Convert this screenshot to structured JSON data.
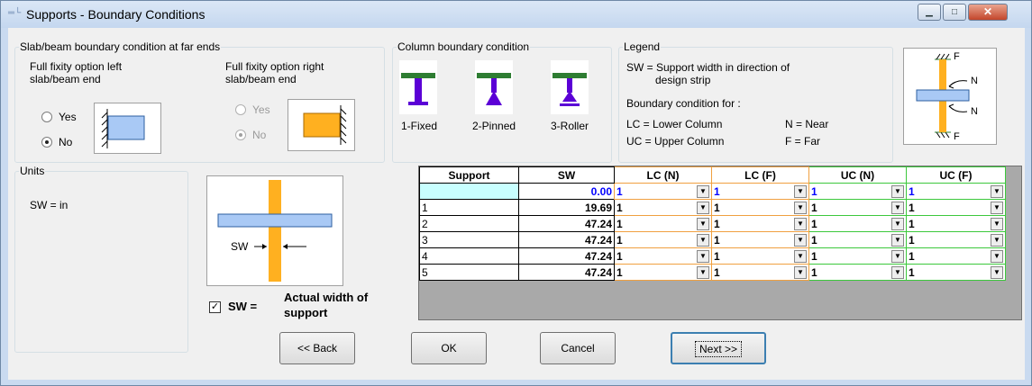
{
  "window": {
    "title": "Supports - Boundary Conditions",
    "icon": "supports-app-icon",
    "controls": {
      "minimize": "minimize-icon",
      "maximize": "maximize-icon",
      "close": "close-icon"
    }
  },
  "slab_group": {
    "legend": "Slab/beam boundary condition at far ends",
    "left": {
      "label_line1": "Full fixity option left",
      "label_line2": "slab/beam end",
      "yes": "Yes",
      "no": "No",
      "selected": "No"
    },
    "right": {
      "label_line1": "Full fixity option right",
      "label_line2": "slab/beam end",
      "yes": "Yes",
      "no": "No",
      "selected": "No",
      "disabled": true
    }
  },
  "column_group": {
    "legend": "Column boundary condition",
    "options": [
      {
        "label": "1-Fixed",
        "icon": "fixed-support-icon"
      },
      {
        "label": "2-Pinned",
        "icon": "pinned-support-icon"
      },
      {
        "label": "3-Roller",
        "icon": "roller-support-icon"
      }
    ]
  },
  "legend_group": {
    "legend": "Legend",
    "sw_line1": "SW = Support width in direction of",
    "sw_line2": "design strip",
    "bc_heading": "Boundary condition for :",
    "lc": "LC = Lower Column",
    "uc": "UC = Upper Column",
    "n": "N = Near",
    "f": "F = Far",
    "diagram_labels": {
      "f_top": "F",
      "n_top": "N",
      "n_bottom": "N",
      "f_bottom": "F"
    }
  },
  "units_group": {
    "legend": "Units",
    "text": "SW = in"
  },
  "support_diagram": {
    "label": "SW"
  },
  "sw_checkbox": {
    "checked": true,
    "prefix": "SW =",
    "line1": "Actual width of",
    "line2": "support"
  },
  "table": {
    "headers": [
      "Support",
      "SW",
      "LC (N)",
      "LC (F)",
      "UC (N)",
      "UC (F)"
    ],
    "rows": [
      {
        "support": "",
        "sw": "0.00",
        "lc_n": "1",
        "lc_f": "1",
        "uc_n": "1",
        "uc_f": "1"
      },
      {
        "support": "1",
        "sw": "19.69",
        "lc_n": "1",
        "lc_f": "1",
        "uc_n": "1",
        "uc_f": "1"
      },
      {
        "support": "2",
        "sw": "47.24",
        "lc_n": "1",
        "lc_f": "1",
        "uc_n": "1",
        "uc_f": "1"
      },
      {
        "support": "3",
        "sw": "47.24",
        "lc_n": "1",
        "lc_f": "1",
        "uc_n": "1",
        "uc_f": "1"
      },
      {
        "support": "4",
        "sw": "47.24",
        "lc_n": "1",
        "lc_f": "1",
        "uc_n": "1",
        "uc_f": "1"
      },
      {
        "support": "5",
        "sw": "47.24",
        "lc_n": "1",
        "lc_f": "1",
        "uc_n": "1",
        "uc_f": "1"
      }
    ]
  },
  "buttons": {
    "back": "<< Back",
    "ok": "OK",
    "cancel": "Cancel",
    "next": "Next >>"
  },
  "colors": {
    "lc_border": "#f0a040",
    "uc_border": "#3cc83c",
    "selected_row": "#c8ffff",
    "selected_text": "#0000ff",
    "slab": "#a9c9f5",
    "column": "#ffb020",
    "support_green": "#2e7d32",
    "support_purple": "#5b00d6"
  }
}
